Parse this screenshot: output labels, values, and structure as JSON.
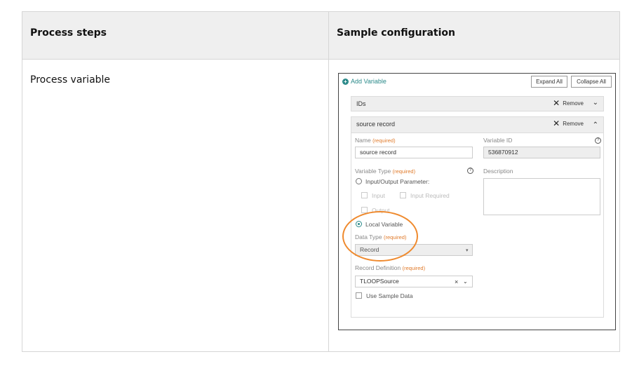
{
  "table": {
    "col1_header": "Process steps",
    "col2_header": "Sample configuration",
    "row1_label": "Process variable"
  },
  "toolbar": {
    "add_variable": "Add Variable",
    "expand_all": "Expand All",
    "collapse_all": "Collapse All"
  },
  "variables": [
    {
      "label": "IDs",
      "remove": "Remove",
      "chevron": "chevron-down-icon"
    },
    {
      "label": "source record",
      "remove": "Remove",
      "chevron": "chevron-up-icon"
    }
  ],
  "form": {
    "name_label": "Name",
    "required": "(required)",
    "name_value": "source record",
    "variable_id_label": "Variable ID",
    "variable_id_value": "536870912",
    "variable_type_label": "Variable Type",
    "description_label": "Description",
    "io_param_label": "Input/Output Parameter:",
    "input_label": "Input",
    "input_required_label": "Input Required",
    "output_label": "Output",
    "local_variable_label": "Local Variable",
    "local_variable_selected": true,
    "data_type_label": "Data Type",
    "data_type_value": "Record",
    "record_def_label": "Record Definition",
    "record_def_value": "TLOOPSource",
    "use_sample_data_label": "Use Sample Data"
  },
  "colors": {
    "accent": "#2b8a8a",
    "required": "#e07a2a",
    "highlight": "#ef8a2e",
    "header_bg": "#efefef"
  }
}
